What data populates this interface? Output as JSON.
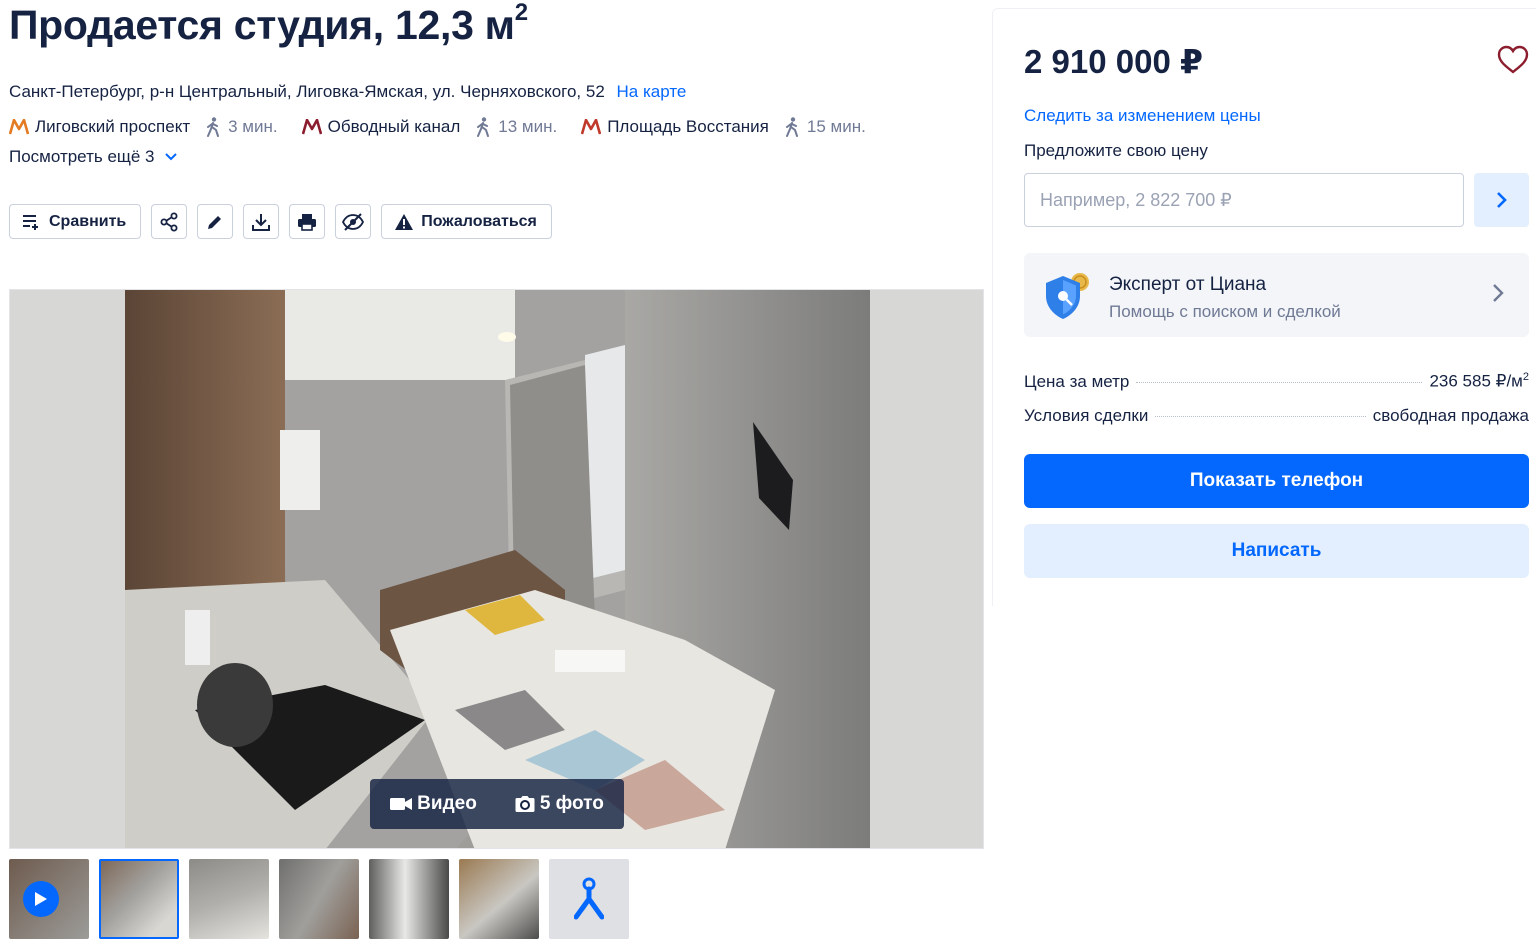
{
  "listing": {
    "title": "Продается студия, 12,3 м",
    "title_sup": "2",
    "address": "Санкт-Петербург, р-н Центральный, Лиговка-Ямская, ул. Черняховского, 52",
    "map_link": "На карте",
    "metro": [
      {
        "name": "Лиговский проспект",
        "time": "3 мин.",
        "color": "#e37b22",
        "icon": "metro-icon"
      },
      {
        "name": "Обводный канал",
        "time": "13 мин.",
        "color": "#8c1d2f",
        "icon": "metro-icon"
      },
      {
        "name": "Площадь Восстания",
        "time": "15 мин.",
        "color": "#c0392b",
        "icon": "metro-icon"
      }
    ],
    "more_stations": "Посмотреть ещё 3"
  },
  "toolbar": {
    "compare_label": "Сравнить",
    "complain_label": "Пожаловаться",
    "icons": [
      "compare-icon",
      "share-icon",
      "edit-icon",
      "download-icon",
      "print-icon",
      "hide-icon",
      "warning-icon"
    ]
  },
  "gallery": {
    "video_label": "Видео",
    "photos_label": "5 фото",
    "thumbnail_count": 7
  },
  "sidebar": {
    "price": "2 910 000 ₽",
    "watch_price": "Следить за изменением цены",
    "offer_label": "Предложите свою цену",
    "offer_placeholder": "Например, 2 822 700 ₽",
    "expert_title": "Эксперт от Циана",
    "expert_subtitle": "Помощь с поиском и сделкой",
    "price_per_meter_label": "Цена за метр",
    "price_per_meter_value": "236 585 ₽/м",
    "price_per_meter_sup": "2",
    "deal_terms_label": "Условия сделки",
    "deal_terms_value": "свободная продажа",
    "show_phone": "Показать телефон",
    "write": "Написать"
  },
  "colors": {
    "accent": "#0468ff",
    "accent_light": "#e3efff",
    "text_primary": "#152242",
    "text_secondary": "#707a95",
    "favorite": "#8c1d2f"
  }
}
